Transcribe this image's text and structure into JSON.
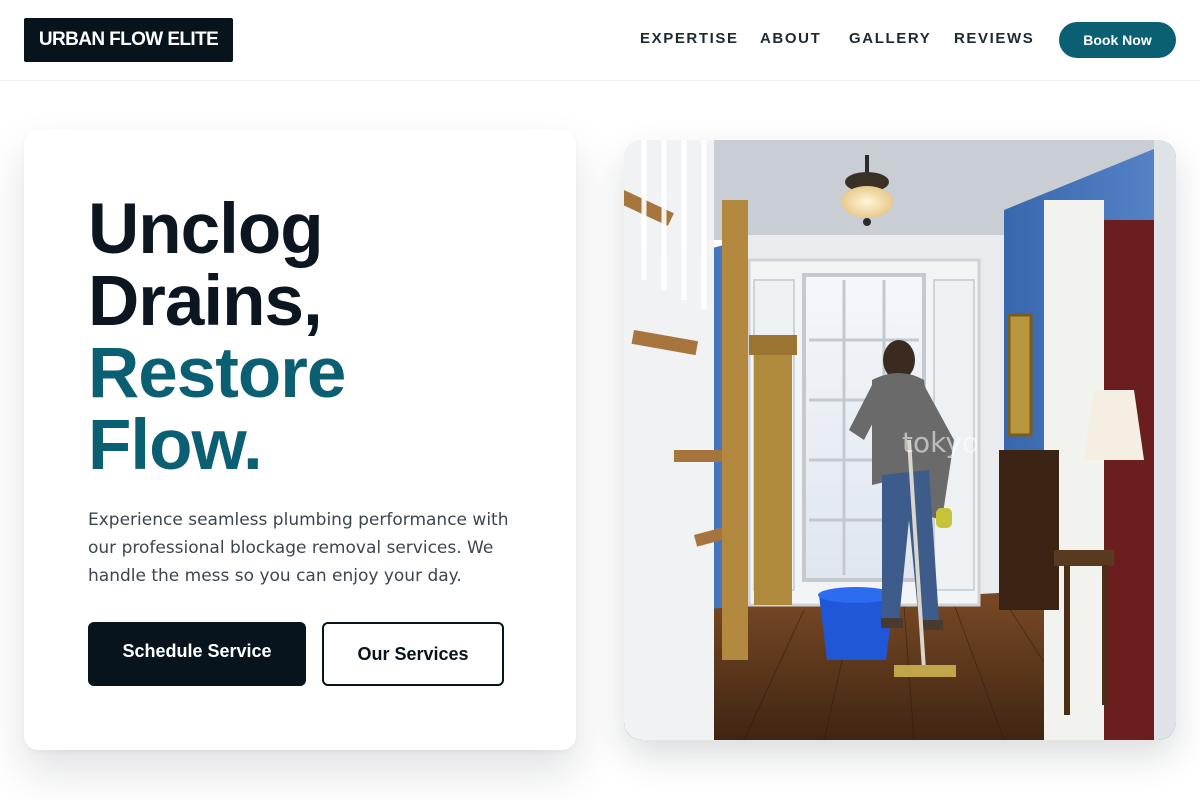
{
  "header": {
    "logo_text": "URBAN FLOW ELITE",
    "nav": [
      {
        "label": "EXPERTISE"
      },
      {
        "label": "ABOUT"
      },
      {
        "label": "GALLERY"
      },
      {
        "label": "REVIEWS"
      }
    ],
    "cta_label": "Book Now"
  },
  "hero": {
    "headline_line1": "Unclog",
    "headline_line2": "Drains,",
    "headline_line3": "Restore",
    "headline_line4": "Flow.",
    "description": "Experience seamless plumbing performance with our professional blockage removal services. We handle the mess so you can enjoy your day.",
    "primary_button": "Schedule Service",
    "secondary_button": "Our Services"
  },
  "photo": {
    "subject": "man-mopping-hallway",
    "watermark": "tokyo"
  },
  "colors": {
    "accent": "#0b5f73",
    "dark": "#07141d"
  }
}
